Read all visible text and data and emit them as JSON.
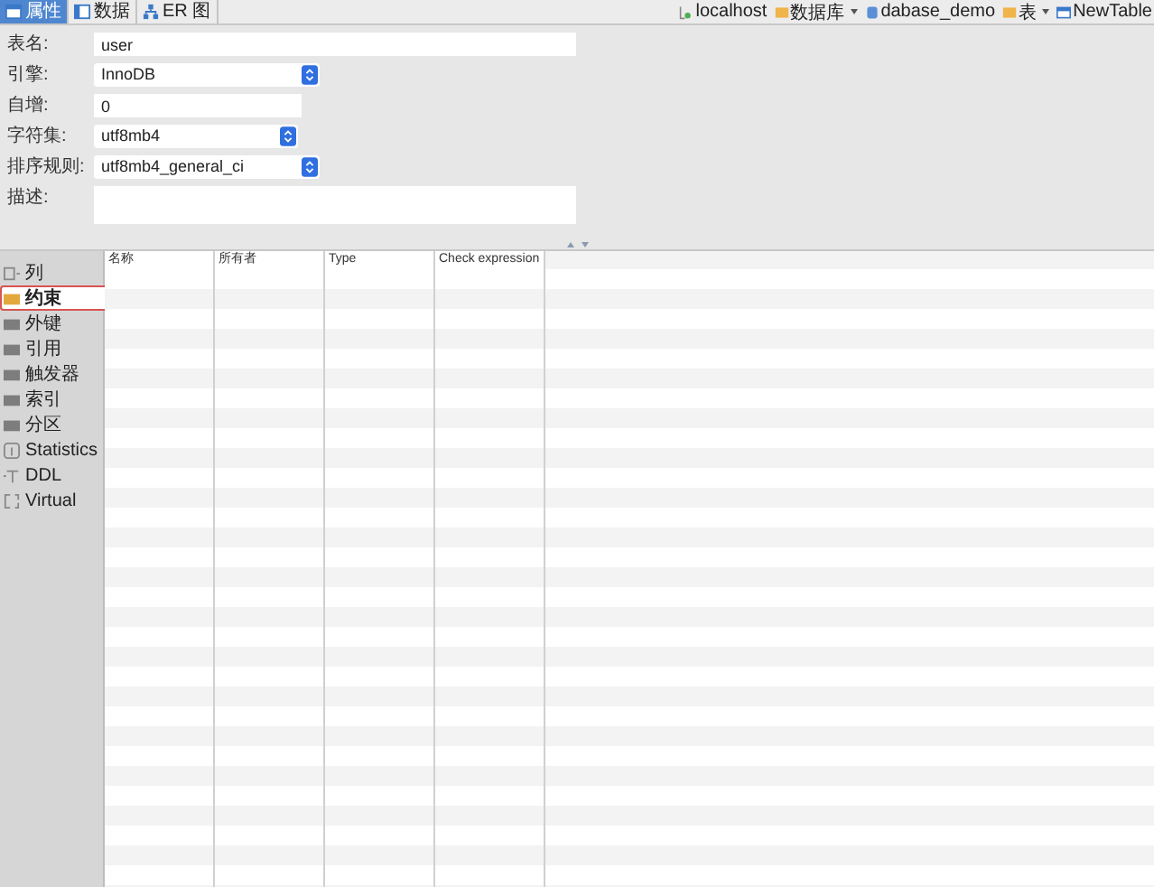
{
  "tabs": [
    {
      "label": "属性",
      "selected": true,
      "kind": "properties"
    },
    {
      "label": "数据",
      "selected": false,
      "kind": "data"
    },
    {
      "label": "ER 图",
      "selected": false,
      "kind": "er"
    }
  ],
  "breadcrumb": [
    {
      "label": "localhost",
      "kind": "server",
      "dropdown": false
    },
    {
      "label": "数据库",
      "kind": "folder",
      "dropdown": true
    },
    {
      "label": "dabase_demo",
      "kind": "database",
      "dropdown": false
    },
    {
      "label": "表",
      "kind": "folder",
      "dropdown": true
    },
    {
      "label": "NewTable",
      "kind": "table",
      "dropdown": false
    }
  ],
  "form": [
    {
      "label": "表名:",
      "value": "user",
      "kind": "text"
    },
    {
      "label": "引擎:",
      "value": "InnoDB",
      "kind": "select"
    },
    {
      "label": "自增:",
      "value": "0",
      "kind": "text"
    },
    {
      "label": "字符集:",
      "value": "utf8mb4",
      "kind": "select"
    },
    {
      "label": "排序规则:",
      "value": "utf8mb4_general_ci",
      "kind": "select"
    },
    {
      "label": "描述:",
      "kind": "textarea"
    }
  ],
  "sidebar": {
    "items": [
      {
        "label": "列",
        "kind": "columns",
        "selected": false
      },
      {
        "label": "约束",
        "kind": "folder",
        "selected": true
      },
      {
        "label": "外键",
        "kind": "folder",
        "selected": false
      },
      {
        "label": "引用",
        "kind": "folder",
        "selected": false
      },
      {
        "label": "触发器",
        "kind": "folder",
        "selected": false
      },
      {
        "label": "索引",
        "kind": "folder",
        "selected": false
      },
      {
        "label": "分区",
        "kind": "folder",
        "selected": false
      },
      {
        "label": "Statistics",
        "kind": "statistics",
        "selected": false
      },
      {
        "label": "DDL",
        "kind": "ddl",
        "selected": false
      },
      {
        "label": "Virtual",
        "kind": "virtual",
        "selected": false
      }
    ]
  },
  "table": {
    "columns": [
      "名称",
      "所有者",
      "Type",
      "Check expression"
    ]
  }
}
